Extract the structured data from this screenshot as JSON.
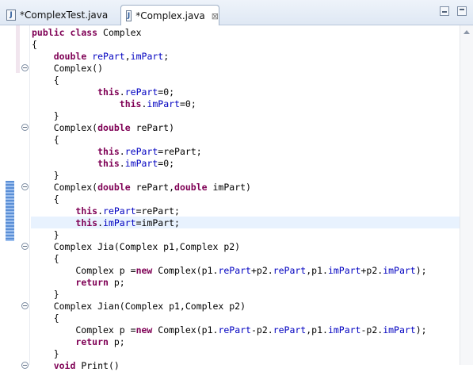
{
  "tabs": [
    {
      "label": "*ComplexTest.java",
      "icon": "java-file-icon",
      "active": false
    },
    {
      "label": "*Complex.java",
      "icon": "java-file-icon",
      "active": true
    }
  ],
  "tab_icon_letter": "J",
  "close_glyph": "⊠",
  "window_controls": [
    "minimize",
    "maximize"
  ],
  "colors": {
    "keyword": "#7f0055",
    "field": "#0000c0",
    "current_line": "#e8f2fe"
  },
  "editor": {
    "current_line_index": 16,
    "lines": [
      [
        [
          "kw",
          "public"
        ],
        [
          "t",
          " "
        ],
        [
          "kw",
          "class"
        ],
        [
          "t",
          " Complex"
        ]
      ],
      [
        [
          "t",
          "{"
        ]
      ],
      [
        [
          "t",
          "    "
        ],
        [
          "kw",
          "double"
        ],
        [
          "t",
          " "
        ],
        [
          "f",
          "rePart"
        ],
        [
          "t",
          ","
        ],
        [
          "f",
          "imPart"
        ],
        [
          "t",
          ";"
        ]
      ],
      [
        [
          "t",
          "    Complex()"
        ]
      ],
      [
        [
          "t",
          "    {"
        ]
      ],
      [
        [
          "t",
          "            "
        ],
        [
          "kw",
          "this"
        ],
        [
          "t",
          "."
        ],
        [
          "f",
          "rePart"
        ],
        [
          "t",
          "=0;"
        ]
      ],
      [
        [
          "t",
          "                "
        ],
        [
          "kw",
          "this"
        ],
        [
          "t",
          "."
        ],
        [
          "f",
          "imPart"
        ],
        [
          "t",
          "=0;"
        ]
      ],
      [
        [
          "t",
          "    }"
        ]
      ],
      [
        [
          "t",
          "    Complex("
        ],
        [
          "kw",
          "double"
        ],
        [
          "t",
          " rePart)"
        ]
      ],
      [
        [
          "t",
          "    {"
        ]
      ],
      [
        [
          "t",
          "            "
        ],
        [
          "kw",
          "this"
        ],
        [
          "t",
          "."
        ],
        [
          "f",
          "rePart"
        ],
        [
          "t",
          "=rePart;"
        ]
      ],
      [
        [
          "t",
          "            "
        ],
        [
          "kw",
          "this"
        ],
        [
          "t",
          "."
        ],
        [
          "f",
          "imPart"
        ],
        [
          "t",
          "=0;"
        ]
      ],
      [
        [
          "t",
          "    }"
        ]
      ],
      [
        [
          "t",
          "    Complex("
        ],
        [
          "kw",
          "double"
        ],
        [
          "t",
          " rePart,"
        ],
        [
          "kw",
          "double"
        ],
        [
          "t",
          " imPart)"
        ]
      ],
      [
        [
          "t",
          "    {"
        ]
      ],
      [
        [
          "t",
          "        "
        ],
        [
          "kw",
          "this"
        ],
        [
          "t",
          "."
        ],
        [
          "f",
          "rePart"
        ],
        [
          "t",
          "=rePart;"
        ]
      ],
      [
        [
          "t",
          "        "
        ],
        [
          "kw",
          "this"
        ],
        [
          "t",
          "."
        ],
        [
          "f",
          "imPart"
        ],
        [
          "t",
          "=imPart;"
        ]
      ],
      [
        [
          "t",
          "    }"
        ]
      ],
      [
        [
          "t",
          "    Complex Jia(Complex p1,Complex p2)"
        ]
      ],
      [
        [
          "t",
          "    {"
        ]
      ],
      [
        [
          "t",
          "        Complex p ="
        ],
        [
          "kw",
          "new"
        ],
        [
          "t",
          " Complex(p1."
        ],
        [
          "f",
          "rePart"
        ],
        [
          "t",
          "+p2."
        ],
        [
          "f",
          "rePart"
        ],
        [
          "t",
          ",p1."
        ],
        [
          "f",
          "imPart"
        ],
        [
          "t",
          "+p2."
        ],
        [
          "f",
          "imPart"
        ],
        [
          "t",
          ");"
        ]
      ],
      [
        [
          "t",
          "        "
        ],
        [
          "kw",
          "return"
        ],
        [
          "t",
          " p;"
        ]
      ],
      [
        [
          "t",
          "    }"
        ]
      ],
      [
        [
          "t",
          "    Complex Jian(Complex p1,Complex p2)"
        ]
      ],
      [
        [
          "t",
          "    {"
        ]
      ],
      [
        [
          "t",
          "        Complex p ="
        ],
        [
          "kw",
          "new"
        ],
        [
          "t",
          " Complex(p1."
        ],
        [
          "f",
          "rePart"
        ],
        [
          "t",
          "-p2."
        ],
        [
          "f",
          "rePart"
        ],
        [
          "t",
          ",p1."
        ],
        [
          "f",
          "imPart"
        ],
        [
          "t",
          "-p2."
        ],
        [
          "f",
          "imPart"
        ],
        [
          "t",
          ");"
        ]
      ],
      [
        [
          "t",
          "        "
        ],
        [
          "kw",
          "return"
        ],
        [
          "t",
          " p;"
        ]
      ],
      [
        [
          "t",
          "    }"
        ]
      ],
      [
        [
          "t",
          "    "
        ],
        [
          "kw",
          "void"
        ],
        [
          "t",
          " Print()"
        ]
      ]
    ]
  }
}
